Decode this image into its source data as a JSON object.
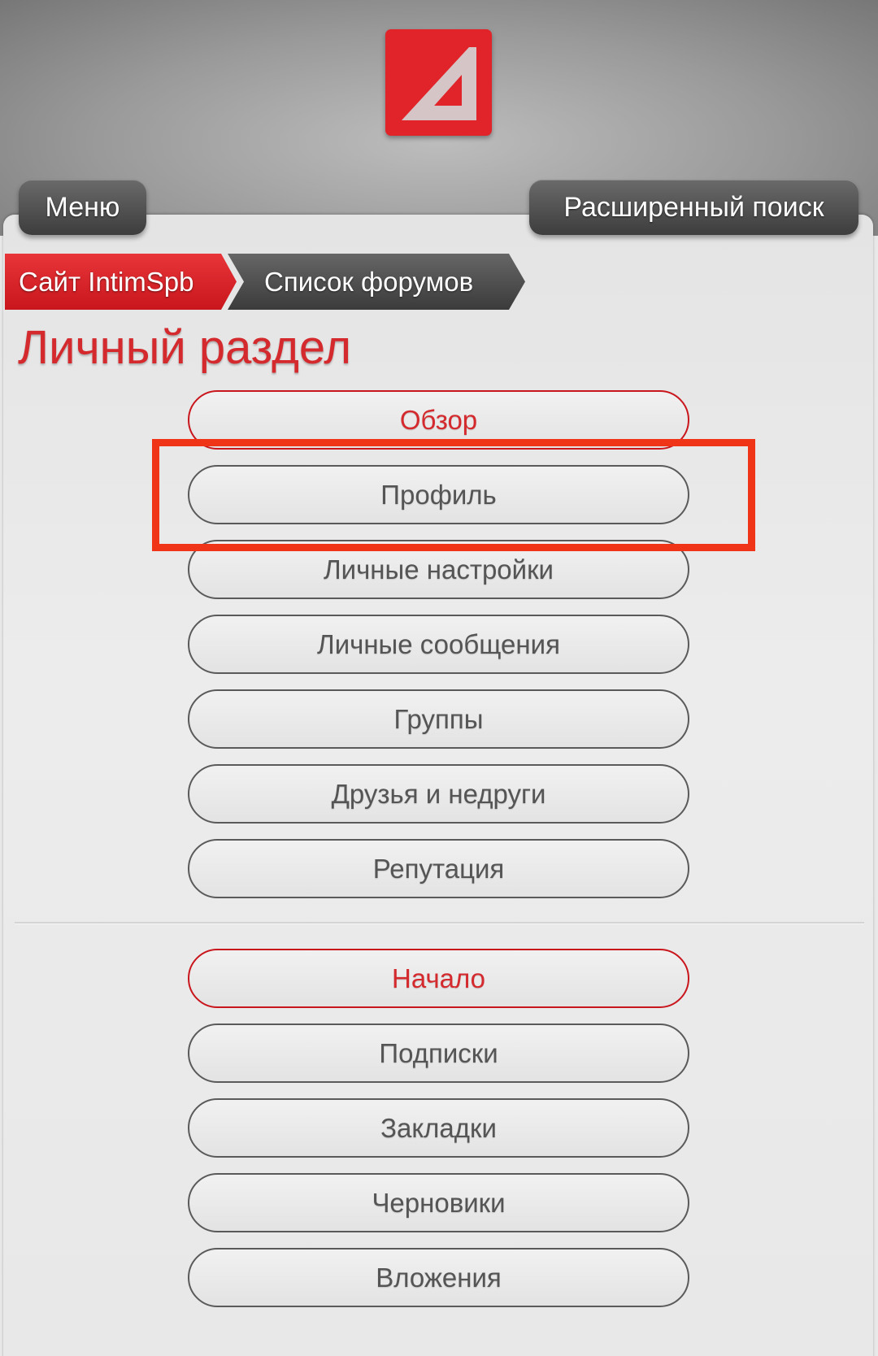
{
  "header": {
    "logo": "brand-logo",
    "menu_label": "Меню",
    "search_label": "Расширенный поиск"
  },
  "breadcrumb": {
    "site_label": "Сайт IntimSpb",
    "forums_label": "Список форумов"
  },
  "page_title": "Личный раздел",
  "primary_nav": [
    {
      "label": "Обзор",
      "active": true
    },
    {
      "label": "Профиль",
      "active": false
    },
    {
      "label": "Личные настройки",
      "active": false
    },
    {
      "label": "Личные сообщения",
      "active": false
    },
    {
      "label": "Группы",
      "active": false
    },
    {
      "label": "Друзья и недруги",
      "active": false
    },
    {
      "label": "Репутация",
      "active": false
    }
  ],
  "secondary_nav": [
    {
      "label": "Начало",
      "active": true
    },
    {
      "label": "Подписки",
      "active": false
    },
    {
      "label": "Закладки",
      "active": false
    },
    {
      "label": "Черновики",
      "active": false
    },
    {
      "label": "Вложения",
      "active": false
    }
  ],
  "colors": {
    "accent": "#d42a2e",
    "highlight": "#f03418"
  }
}
